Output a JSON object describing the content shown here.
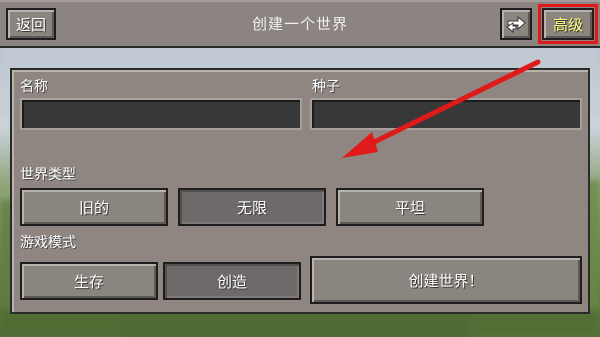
{
  "header": {
    "back_label": "返回",
    "title": "创建一个世界",
    "advanced_label": "高级",
    "swap_icon": "arrows-swap-icon"
  },
  "form": {
    "name_label": "名称",
    "name_value": "",
    "seed_label": "种子",
    "seed_value": "",
    "world_type_label": "世界类型",
    "world_types": [
      "旧的",
      "无限",
      "平坦"
    ],
    "selected_world_type": "无限",
    "game_mode_label": "游戏模式",
    "game_modes": [
      "生存",
      "创造"
    ],
    "selected_game_mode": "创造",
    "create_button_label": "创建世界！"
  },
  "colors": {
    "annotation": "#e01a1a",
    "panel": "#8f8682",
    "field": "#383838"
  }
}
